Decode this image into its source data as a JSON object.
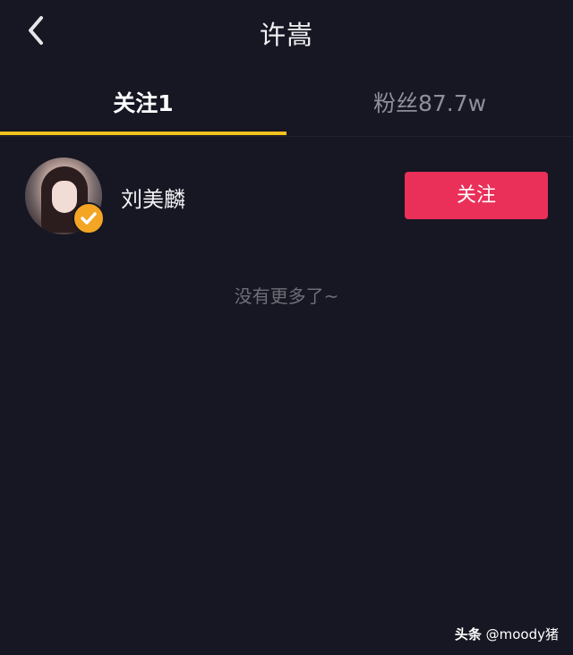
{
  "header": {
    "title": "许嵩",
    "back_icon": "chevron-left-icon"
  },
  "tabs": [
    {
      "label": "关注1",
      "active": true
    },
    {
      "label": "粉丝87.7w",
      "active": false
    }
  ],
  "colors": {
    "background": "#161722",
    "tab_indicator": "#f4c21d",
    "follow_button": "#ea2f59",
    "verified_badge": "#f4a523"
  },
  "following_list": [
    {
      "name": "刘美麟",
      "verified": true,
      "action_label": "关注"
    }
  ],
  "end_message": "没有更多了~",
  "watermark": {
    "brand": "头条",
    "handle": "@moody猪"
  }
}
